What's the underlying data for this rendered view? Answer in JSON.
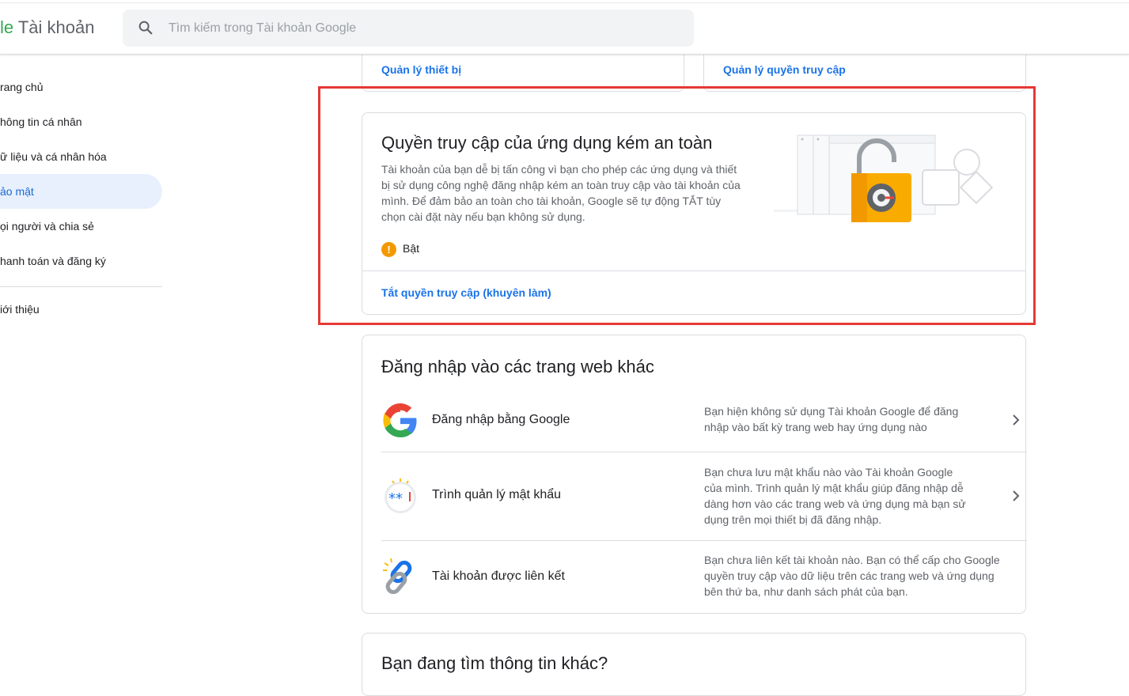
{
  "header": {
    "brand_logo_fragment": "le",
    "brand_title": "Tài khoản",
    "search_placeholder": "Tìm kiếm trong Tài khoản Google"
  },
  "sidebar": {
    "items": [
      {
        "label": "rang chủ",
        "active": false
      },
      {
        "label": "hông tin cá nhân",
        "active": false
      },
      {
        "label": "ữ liệu và cá nhân hóa",
        "active": false
      },
      {
        "label": "ảo mật",
        "active": true
      },
      {
        "label": "ọi người và chia sẻ",
        "active": false
      },
      {
        "label": "hanh toán và đăng ký",
        "active": false
      }
    ],
    "footer_item": "iới thiệu"
  },
  "top_cards": {
    "device_link": "Quản lý thiết bị",
    "access_link": "Quản lý quyền truy cập"
  },
  "less_secure_apps": {
    "title": "Quyền truy cập của ứng dụng kém an toàn",
    "description": "Tài khoản của bạn dễ bị tấn công vì bạn cho phép các ứng dụng và thiết bị sử dụng công nghệ đăng nhập kém an toàn truy cập vào tài khoản của mình. Để đảm bảo an toàn cho tài khoản, Google sẽ tự động TẮT tùy chọn cài đặt này nếu bạn không sử dụng.",
    "status_icon": "warning-icon",
    "status": "Bật",
    "action_link": "Tắt quyền truy cập (khuyên làm)",
    "highlight_color": "#e53935"
  },
  "signin_other_sites": {
    "title": "Đăng nhập vào các trang web khác",
    "rows": [
      {
        "icon": "google-g-icon",
        "name": "Đăng nhập bằng Google",
        "info": "Bạn hiện không sử dụng Tài khoản Google để đăng nhập vào bất kỳ trang web hay ứng dụng nào"
      },
      {
        "icon": "password-manager-icon",
        "name": "Trình quản lý mật khẩu",
        "info": "Bạn chưa lưu mật khẩu nào vào Tài khoản Google của mình. Trình quản lý mật khẩu giúp đăng nhập dễ dàng hơn vào các trang web và ứng dụng mà bạn sử dụng trên mọi thiết bị đã đăng nhập."
      },
      {
        "icon": "linked-accounts-icon",
        "name": "Tài khoản được liên kết",
        "info": "Bạn chưa liên kết tài khoản nào. Bạn có thể cấp cho Google quyền truy cập vào dữ liệu trên các trang web và ứng dụng bên thứ ba, như danh sách phát của bạn."
      }
    ]
  },
  "more_info": {
    "title": "Bạn đang tìm thông tin khác?"
  },
  "colors": {
    "link": "#1a73e8",
    "active_nav_bg": "#e8f0fe",
    "warning": "#f29900"
  }
}
